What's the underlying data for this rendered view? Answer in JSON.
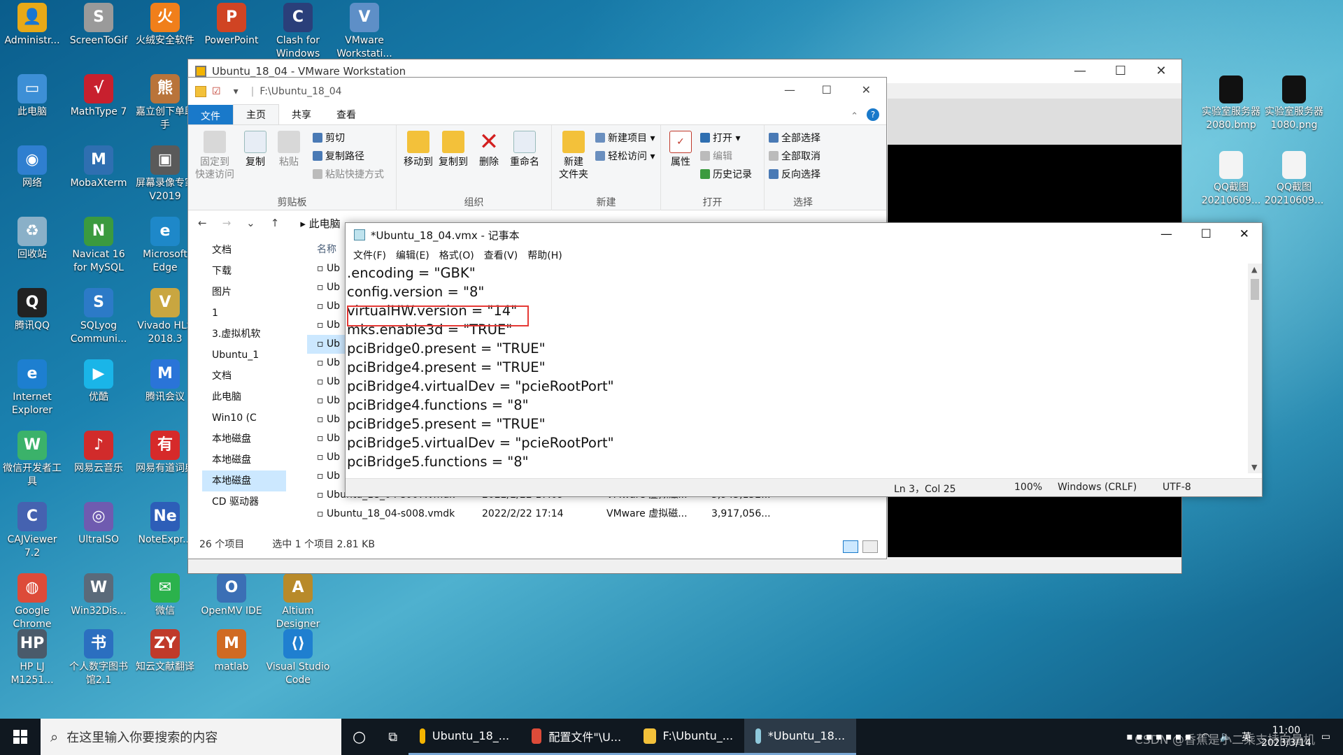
{
  "desktop": {
    "icons": [
      {
        "label": "Administr...",
        "color": "#e8a917",
        "glyph": "👤"
      },
      {
        "label": "ScreenToGif",
        "color": "#9a9a9a",
        "glyph": "S"
      },
      {
        "label": "火绒安全软件",
        "color": "#f07f1b",
        "glyph": "火"
      },
      {
        "label": "PowerPoint",
        "color": "#d04423",
        "glyph": "P"
      },
      {
        "label": "Clash for Windows",
        "color": "#2a3f7a",
        "glyph": "C"
      },
      {
        "label": "VMware Workstati...",
        "color": "#5e8fc7",
        "glyph": "V"
      },
      {
        "label": "此电脑",
        "color": "#3d8fd6",
        "glyph": "▭"
      },
      {
        "label": "MathType 7",
        "color": "#c8202e",
        "glyph": "√"
      },
      {
        "label": "嘉立创下单助手",
        "color": "#b9743a",
        "glyph": "熊"
      },
      {
        "label": "网络",
        "color": "#2f7fd0",
        "glyph": "◉"
      },
      {
        "label": "MobaXterm",
        "color": "#2f6fb1",
        "glyph": "M"
      },
      {
        "label": "屏幕录像专家V2019",
        "color": "#5a5a5a",
        "glyph": "▣"
      },
      {
        "label": "回收站",
        "color": "#8ab0c8",
        "glyph": "♻"
      },
      {
        "label": "Navicat 16 for MySQL",
        "color": "#3b9a3f",
        "glyph": "N"
      },
      {
        "label": "Microsoft Edge",
        "color": "#1e88c9",
        "glyph": "e"
      },
      {
        "label": "腾讯QQ",
        "color": "#222222",
        "glyph": "Q"
      },
      {
        "label": "SQLyog Communi...",
        "color": "#2c7ac7",
        "glyph": "S"
      },
      {
        "label": "Vivado HLS 2018.3",
        "color": "#c9a640",
        "glyph": "V"
      },
      {
        "label": "Internet Explorer",
        "color": "#1d7fd0",
        "glyph": "e"
      },
      {
        "label": "优酷",
        "color": "#1ab5e8",
        "glyph": "▶"
      },
      {
        "label": "腾讯会议",
        "color": "#2a74d8",
        "glyph": "M"
      },
      {
        "label": "微信开发者工具",
        "color": "#3bb26a",
        "glyph": "W"
      },
      {
        "label": "网易云音乐",
        "color": "#d12b2b",
        "glyph": "♪"
      },
      {
        "label": "网易有道词典",
        "color": "#d62a2a",
        "glyph": "有"
      },
      {
        "label": "CAJViewer 7.2",
        "color": "#4562b0",
        "glyph": "C"
      },
      {
        "label": "UltraISO",
        "color": "#6f5bb0",
        "glyph": "◎"
      },
      {
        "label": "NoteExpr...",
        "color": "#2d5eb8",
        "glyph": "Ne"
      },
      {
        "label": "Google Chrome",
        "color": "#dd4b39",
        "glyph": "◍"
      },
      {
        "label": "Win32Dis...",
        "color": "#5a6a7a",
        "glyph": "W"
      },
      {
        "label": "微信",
        "color": "#2bb24c",
        "glyph": "✉"
      },
      {
        "label": "OpenMV IDE",
        "color": "#3b6fb5",
        "glyph": "O"
      },
      {
        "label": "Altium Designer",
        "color": "#b88a2a",
        "glyph": "A"
      },
      {
        "label": "HP LJ M1251...",
        "color": "#4a5a6a",
        "glyph": "HP"
      },
      {
        "label": "个人数字图书馆2.1",
        "color": "#2b6fc0",
        "glyph": "书"
      },
      {
        "label": "知云文献翻译",
        "color": "#c03a2a",
        "glyph": "ZY"
      },
      {
        "label": "matlab",
        "color": "#d06a22",
        "glyph": "M"
      },
      {
        "label": "Visual Studio Code",
        "color": "#1f7fd0",
        "glyph": "⟨⟩"
      }
    ],
    "right_icons": [
      {
        "label": "实验室服务器2080.bmp"
      },
      {
        "label": "实验室服务器1080.png"
      },
      {
        "label": "QQ截图20210609..."
      },
      {
        "label": "QQ截图20210609..."
      }
    ]
  },
  "vmware": {
    "title": "Ubuntu_18_04 - VMware Workstation",
    "min": "—",
    "max": "☐",
    "close": "✕"
  },
  "explorer": {
    "path_title": "F:\\Ubuntu_18_04",
    "tabs": {
      "file": "文件",
      "home": "主页",
      "share": "共享",
      "view": "查看"
    },
    "ribbon": {
      "pin": "固定到\n快速访问",
      "copy": "复制",
      "paste": "粘贴",
      "cut": "剪切",
      "copy_path": "复制路径",
      "paste_shortcut": "粘贴快捷方式",
      "clipboard": "剪贴板",
      "move_to": "移动到",
      "copy_to": "复制到",
      "delete": "删除",
      "rename": "重命名",
      "organize": "组织",
      "new_folder": "新建\n文件夹",
      "new_item": "新建项目 ▾",
      "easy_access": "轻松访问 ▾",
      "new": "新建",
      "properties": "属性",
      "open": "打开 ▾",
      "edit": "编辑",
      "history": "历史记录",
      "open_group": "打开",
      "select_all": "全部选择",
      "select_none": "全部取消",
      "invert": "反向选择",
      "select": "选择"
    },
    "nav": {
      "back": "←",
      "forward": "→",
      "down": "⌄",
      "up": "↑",
      "crumb": "此电脑"
    },
    "pane": [
      "文档",
      "下载",
      "图片",
      "1",
      "3.虚拟机软",
      "Ubuntu_1",
      "文档",
      "此电脑",
      "Win10 (C",
      "本地磁盘",
      "本地磁盘",
      "本地磁盘",
      "CD 驱动器"
    ],
    "column_name": "名称",
    "files_partial": [
      "Ub",
      "Ub",
      "Ub",
      "Ub",
      "Ub",
      "Ub",
      "Ub",
      "Ub",
      "Ub",
      "Ub",
      "Ub",
      "Ub"
    ],
    "rows": [
      {
        "name": "Ubuntu_18_04-s007.vmdk",
        "date": "2022/2/22 17:09",
        "type": "VMware 虚拟磁...",
        "size": "3,945,152..."
      },
      {
        "name": "Ubuntu_18_04-s008.vmdk",
        "date": "2022/2/22 17:14",
        "type": "VMware 虚拟磁...",
        "size": "3,917,056..."
      }
    ],
    "status": {
      "count": "26 个项目",
      "selected": "选中 1 个项目  2.81 KB"
    }
  },
  "notepad": {
    "title": "*Ubuntu_18_04.vmx - 记事本",
    "menu": [
      "文件(F)",
      "编辑(E)",
      "格式(O)",
      "查看(V)",
      "帮助(H)"
    ],
    "lines": [
      ".encoding = \"GBK\"",
      "config.version = \"8\"",
      "virtualHW.version = \"14\"",
      "mks.enable3d = \"TRUE\"",
      "pciBridge0.present = \"TRUE\"",
      "pciBridge4.present = \"TRUE\"",
      "pciBridge4.virtualDev = \"pcieRootPort\"",
      "pciBridge4.functions = \"8\"",
      "pciBridge5.present = \"TRUE\"",
      "pciBridge5.virtualDev = \"pcieRootPort\"",
      "pciBridge5.functions = \"8\""
    ],
    "status": {
      "pos": "Ln 3，Col 25",
      "zoom": "100%",
      "eol": "Windows (CRLF)",
      "enc": "UTF-8"
    }
  },
  "taskbar": {
    "search_placeholder": "在这里输入你要搜索的内容",
    "apps": [
      {
        "label": "Ubuntu_18_...",
        "color": "#f4b400"
      },
      {
        "label": "配置文件\"\\U...",
        "color": "#dd4b39"
      },
      {
        "label": "F:\\Ubuntu_...",
        "color": "#f3c13a"
      },
      {
        "label": "*Ubuntu_18...",
        "color": "#8fc9dc"
      }
    ],
    "ime": "英",
    "time": "11:00",
    "date": "2023/3/14",
    "watermark": "CSDN @香蕉是小二乘支持向量机"
  }
}
